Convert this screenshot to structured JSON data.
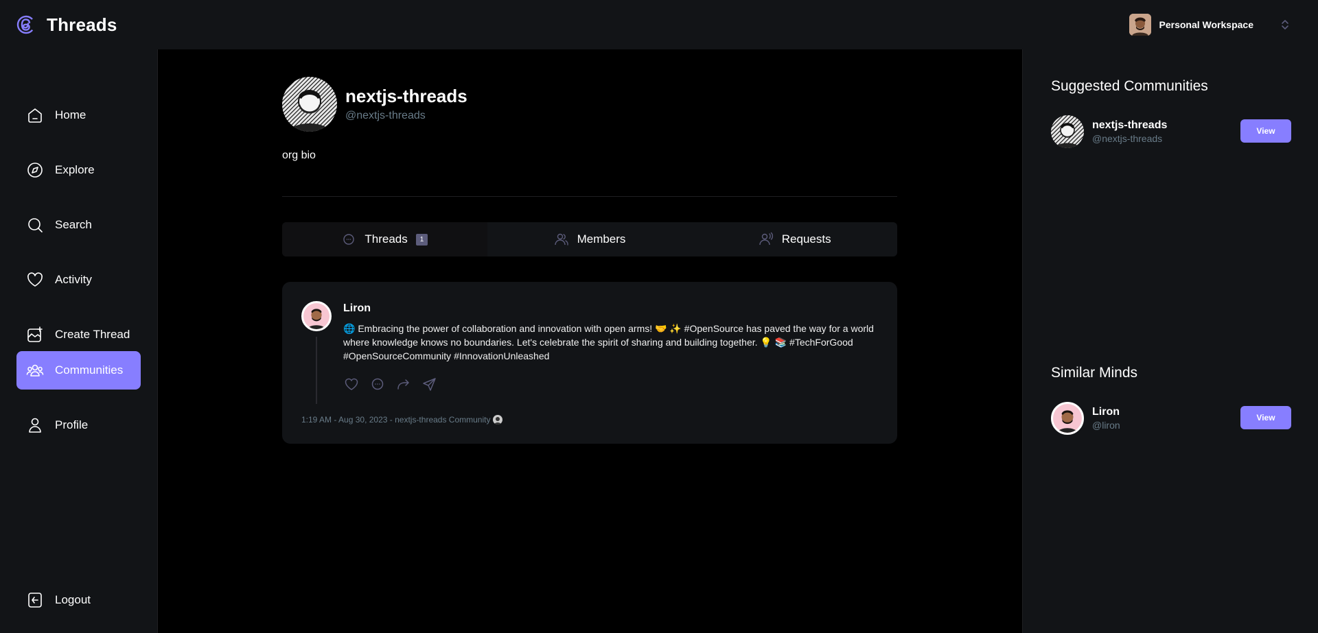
{
  "app": {
    "name": "Threads",
    "accent": "#877eff"
  },
  "workspace": {
    "name": "Personal Workspace"
  },
  "nav": {
    "items": [
      {
        "label": "Home",
        "icon": "home-icon"
      },
      {
        "label": "Explore",
        "icon": "compass-icon"
      },
      {
        "label": "Search",
        "icon": "search-icon"
      },
      {
        "label": "Activity",
        "icon": "heart-icon"
      },
      {
        "label": "Create Thread",
        "icon": "create-icon"
      },
      {
        "label": "Communities",
        "icon": "communities-icon",
        "active": true
      },
      {
        "label": "Profile",
        "icon": "user-icon"
      }
    ],
    "logout": "Logout"
  },
  "community": {
    "name": "nextjs-threads",
    "handle": "@nextjs-threads",
    "bio": "org bio"
  },
  "tabs": [
    {
      "label": "Threads",
      "badge": "1",
      "active": true
    },
    {
      "label": "Members"
    },
    {
      "label": "Requests"
    }
  ],
  "thread": {
    "author": "Liron",
    "content": "🌐 Embracing the power of collaboration and innovation with open arms! 🤝 ✨ #OpenSource has paved the way for a world where knowledge knows no boundaries. Let's celebrate the spirit of sharing and building together. 💡 📚 #TechForGood #OpenSourceCommunity #InnovationUnleashed",
    "meta": "1:19 AM - Aug 30, 2023 - nextjs-threads Community"
  },
  "suggested": {
    "title": "Suggested Communities",
    "items": [
      {
        "name": "nextjs-threads",
        "handle": "@nextjs-threads",
        "button": "View"
      }
    ]
  },
  "similar": {
    "title": "Similar Minds",
    "items": [
      {
        "name": "Liron",
        "handle": "@liron",
        "button": "View"
      }
    ]
  }
}
